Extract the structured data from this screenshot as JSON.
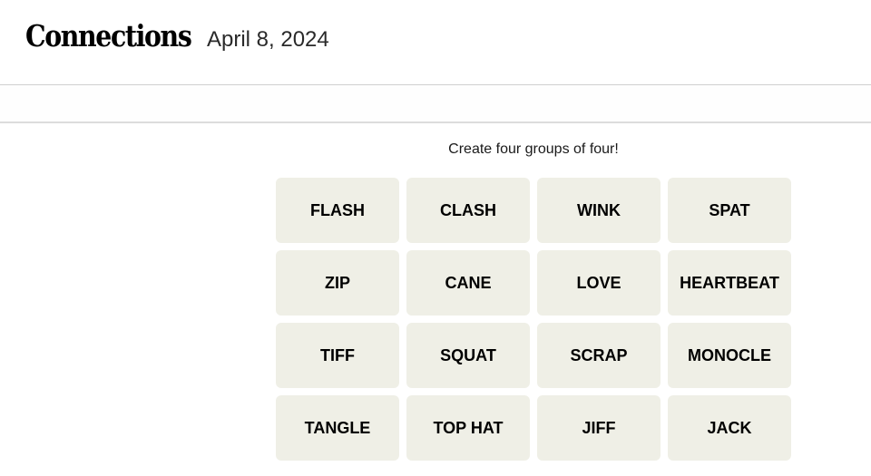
{
  "header": {
    "title": "Connections",
    "date": "April 8, 2024"
  },
  "game": {
    "instructions": "Create four groups of four!",
    "tiles": [
      "FLASH",
      "CLASH",
      "WINK",
      "SPAT",
      "ZIP",
      "CANE",
      "LOVE",
      "HEARTBEAT",
      "TIFF",
      "SQUAT",
      "SCRAP",
      "MONOCLE",
      "TANGLE",
      "TOP HAT",
      "JIFF",
      "JACK"
    ]
  },
  "colors": {
    "tile_background": "#efefe6",
    "tile_text": "#000000",
    "divider": "#d0d0d0"
  }
}
